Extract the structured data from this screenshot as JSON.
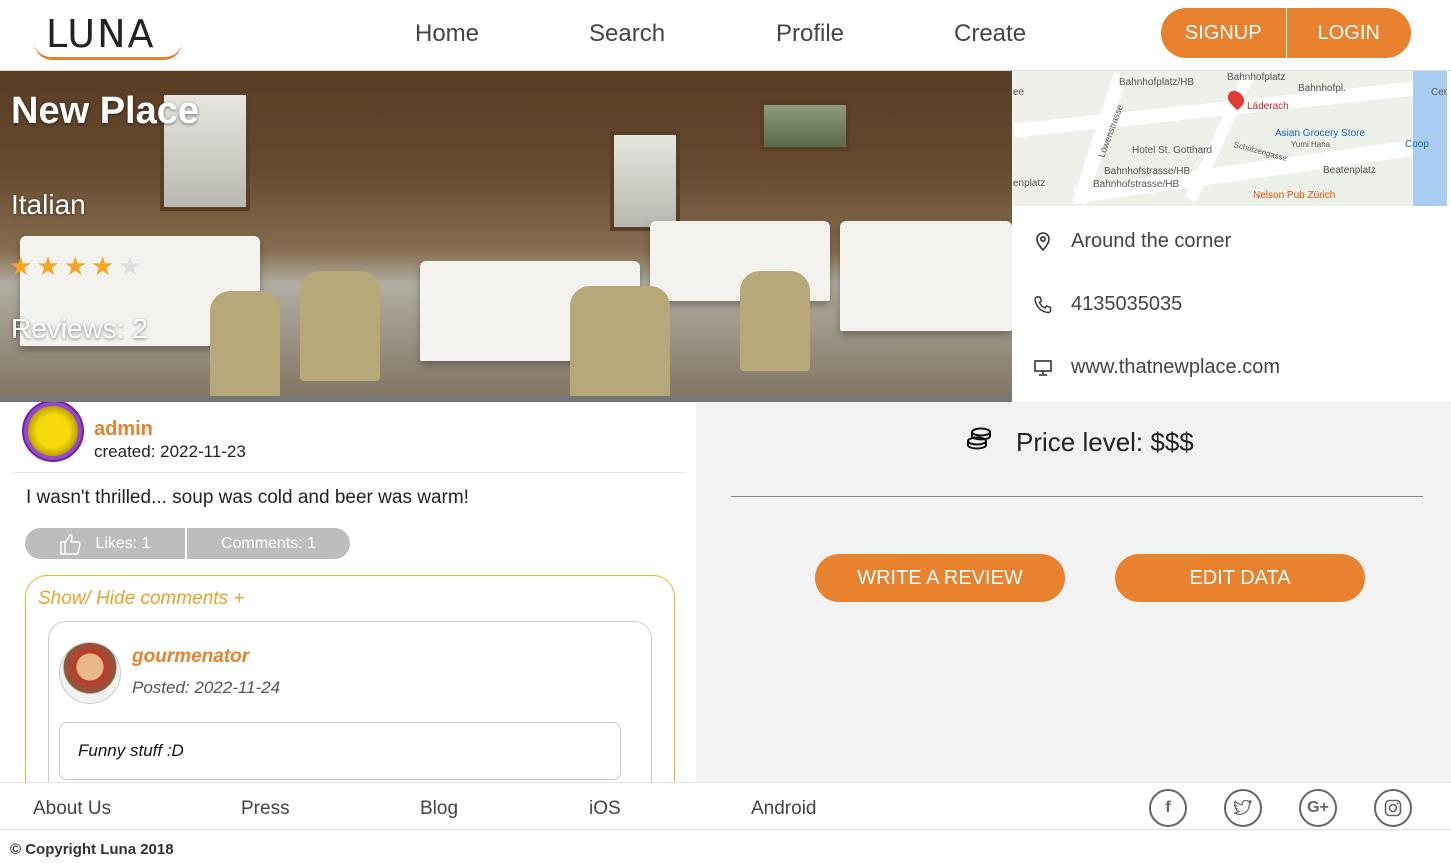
{
  "app": {
    "logo_text": "LUNA"
  },
  "nav": {
    "items": [
      {
        "label": "Home"
      },
      {
        "label": "Search"
      },
      {
        "label": "Profile"
      },
      {
        "label": "Create"
      }
    ],
    "signup_label": "SIGNUP",
    "login_label": "LOGIN"
  },
  "restaurant": {
    "name": "New Place",
    "cuisine": "Italian",
    "rating": 4,
    "rating_max": 5,
    "reviews_label": "Reviews: 2",
    "address": "Around the corner",
    "phone": "4135035035",
    "website": "www.thatnewplace.com",
    "price_level_label": "Price level: $$$"
  },
  "map": {
    "labels": {
      "l1": "Bahnhofplatz/HB",
      "l2": "Bahnhofplatz",
      "l3": "Bahnhofpl.",
      "l4": "Läderach",
      "l5": "Asian Grocery Store",
      "l6": "Yumi Hana",
      "l7": "Coop",
      "l8": "Hotel St. Gotthard",
      "l9": "Schützengasse",
      "l10": "Löwenstrasse",
      "l11": "Beatenplatz",
      "l12": "Bahnhofstrasse/HB",
      "l13": "Bahnhofstrasse/HB",
      "l14": "Nelson Pub Zürich",
      "l15": "enplatz",
      "l16": "Cen",
      "l17": "ee"
    }
  },
  "actions": {
    "write_review": "WRITE A REVIEW",
    "edit_data": "EDIT DATA"
  },
  "review": {
    "user": "admin",
    "created": "created: 2022-11-23",
    "text": "I wasn't thrilled... soup was cold and beer was warm!",
    "likes_label": "Likes: 1",
    "comments_label": "Comments: 1",
    "toggle_label": "Show/ Hide comments +",
    "comment": {
      "user": "gourmenator",
      "posted": "Posted: 2022-11-24",
      "text": "Funny stuff :D"
    }
  },
  "footer": {
    "links": [
      "About Us",
      "Press",
      "Blog",
      "iOS",
      "Android"
    ],
    "social": [
      "facebook-icon",
      "twitter-icon",
      "google-plus-icon",
      "instagram-icon"
    ],
    "copyright": "© Copyright Luna 2018"
  },
  "colors": {
    "accent": "#e8822e",
    "star": "#f5a623",
    "comment_border": "#f0b429"
  }
}
